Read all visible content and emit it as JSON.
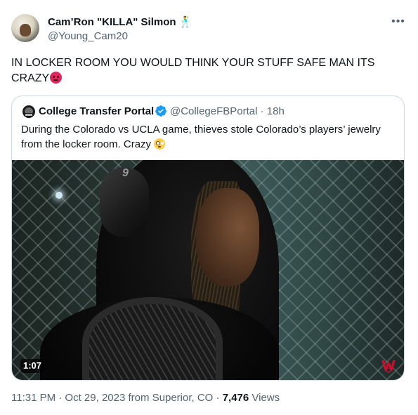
{
  "author": {
    "display_name": "Cam’Ron \"KILLA\" Silmon",
    "name_emoji": "🕺",
    "handle": "@Young_Cam20"
  },
  "more_icon": "more-horizontal-icon",
  "tweet": {
    "text": "IN LOCKER ROOM YOU WOULD THINK YOUR STUFF SAFE MAN ITS CRAZY",
    "emoji": "angry-face"
  },
  "quoted": {
    "name": "College Transfer Portal",
    "verified_icon": "verified-badge-icon",
    "handle_time": "@CollegeFBPortal · 18h",
    "text": "During the Colorado vs UCLA game, thieves stole Colorado’s players’ jewelry from the locker room. Crazy",
    "emoji": "flushed-face",
    "video": {
      "duration": "1:07",
      "jersey_number": "9"
    }
  },
  "meta": {
    "timestamp": "11:31 PM · Oct 29, 2023 from Superior, CO · ",
    "views_count": "7,476",
    "views_label": " Views"
  },
  "colors": {
    "text": "#0f1419",
    "secondary": "#536471",
    "border": "#cfd9de",
    "verified": "#1d9bf0"
  }
}
